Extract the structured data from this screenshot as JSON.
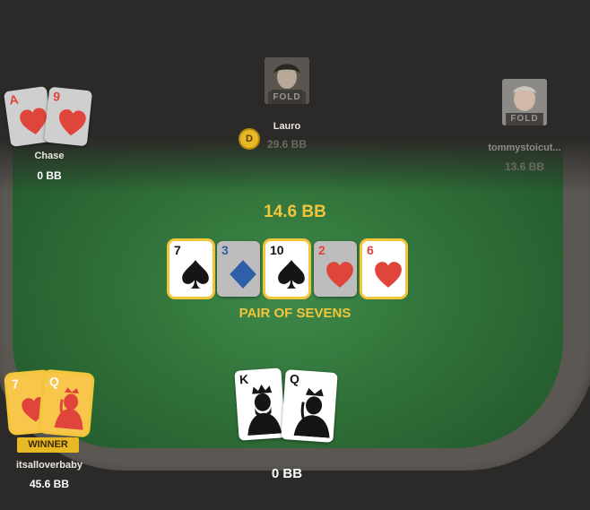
{
  "pot": "14.6 BB",
  "hand_name": "PAIR OF SEVENS",
  "dealer_button": "D",
  "players": {
    "chase": {
      "name": "Chase",
      "stack": "0 BB",
      "cards": [
        {
          "rank": "A",
          "suit": "hearts"
        },
        {
          "rank": "9",
          "suit": "hearts"
        }
      ]
    },
    "lauro": {
      "name": "Lauro",
      "stack": "29.6 BB",
      "status": "FOLD"
    },
    "tommy": {
      "name": "tommystoicut...",
      "stack": "13.6 BB",
      "status": "FOLD"
    },
    "winner": {
      "name": "itsalloverbaby",
      "stack": "45.6 BB",
      "badge": "WINNER",
      "cards": [
        {
          "rank": "7",
          "suit": "hearts"
        },
        {
          "rank": "Q",
          "suit": "hearts"
        }
      ]
    },
    "hero": {
      "stack": "0 BB",
      "cards": [
        {
          "rank": "K",
          "suit": "spades"
        },
        {
          "rank": "Q",
          "suit": "spades"
        }
      ]
    }
  },
  "board": [
    {
      "rank": "7",
      "suit": "spades",
      "highlighted": true
    },
    {
      "rank": "3",
      "suit": "diamonds",
      "highlighted": false
    },
    {
      "rank": "10",
      "suit": "spades",
      "highlighted": true
    },
    {
      "rank": "2",
      "suit": "hearts",
      "highlighted": false
    },
    {
      "rank": "6",
      "suit": "hearts",
      "highlighted": true
    }
  ],
  "colors": {
    "felt": "#2f7038",
    "accent": "#f2c53a",
    "background": "#2c2a28"
  }
}
